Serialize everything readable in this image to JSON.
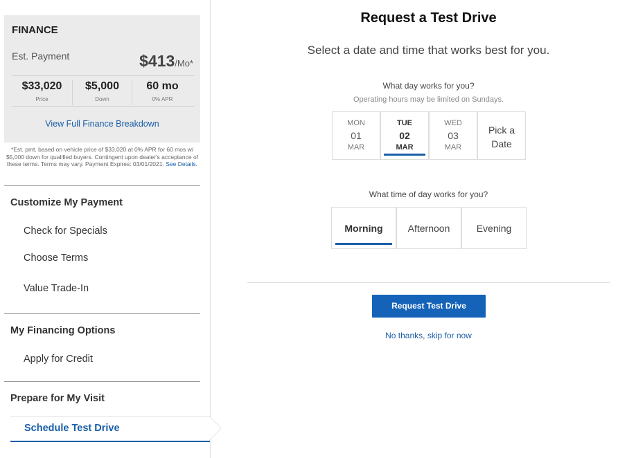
{
  "finance": {
    "title": "FINANCE",
    "est_label": "Est. Payment",
    "amount": "$413",
    "per": "/Mo*",
    "price_value": "$33,020",
    "price_label": "Price",
    "down_value": "$5,000",
    "down_label": "Down",
    "term_value": "60 mo",
    "term_label": "0% APR",
    "view_link": "View Full Finance Breakdown",
    "disclaimer": "*Est. pmt. based on vehicle price of $33,020 at 0% APR for 60 mos w/ $5,000 down for qualified buyers. Contingent upon dealer's acceptance of these terms. Terms may vary. Payment Expires: 03/01/2021.",
    "see_details": "See Details."
  },
  "sidebar": {
    "customize_heading": "Customize My Payment",
    "items_customize": [
      "Check for Specials",
      "Choose Terms",
      "Value Trade-In"
    ],
    "financing_heading": "My Financing Options",
    "items_financing": [
      "Apply for Credit"
    ],
    "visit_heading": "Prepare for My Visit",
    "active_item": "Schedule Test Drive"
  },
  "main": {
    "title": "Request a Test Drive",
    "subtitle": "Select a date and time that works best for you.",
    "day_question": "What day works for you?",
    "day_note": "Operating hours may be limited on Sundays.",
    "days": [
      {
        "dow": "MON",
        "date": "01",
        "month": "MAR"
      },
      {
        "dow": "TUE",
        "date": "02",
        "month": "MAR"
      },
      {
        "dow": "WED",
        "date": "03",
        "month": "MAR"
      }
    ],
    "pick_date": "Pick a Date",
    "time_question": "What time of day works for you?",
    "times": [
      "Morning",
      "Afternoon",
      "Evening"
    ],
    "request_button": "Request Test Drive",
    "skip_link": "No thanks, skip for now"
  },
  "colors": {
    "accent": "#1a5ea8",
    "button": "#1463b8",
    "panel": "#ebebeb"
  }
}
